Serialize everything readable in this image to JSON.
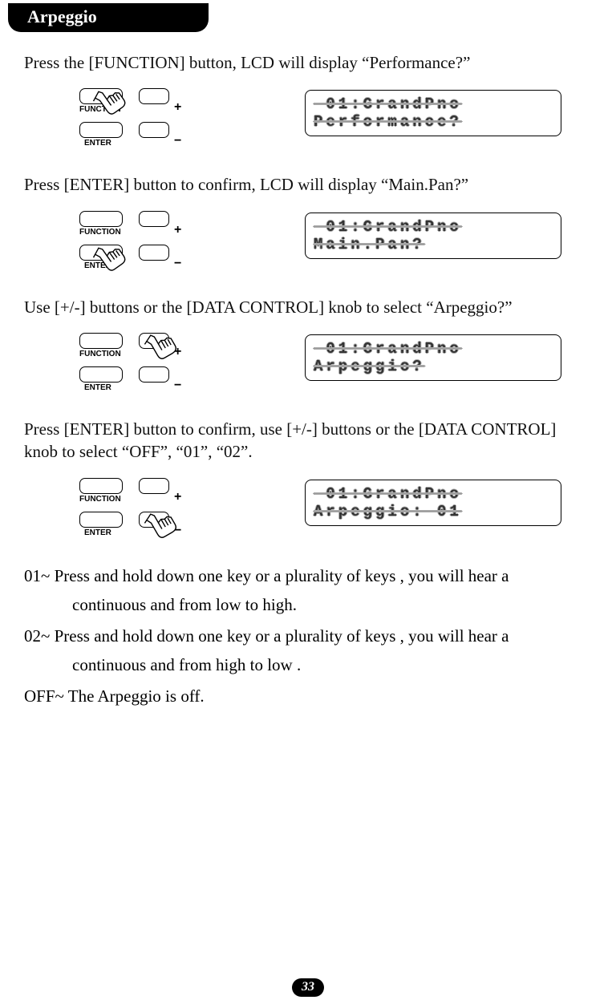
{
  "header": "Arpeggio",
  "steps": [
    {
      "instruction": "Press the [FUNCTION] button, LCD will display “Performance?”",
      "lcd": {
        "line1": " 01:GrandPno",
        "line2": "Performance?"
      }
    },
    {
      "instruction": "Press [ENTER] button to confirm, LCD will display “Main.Pan?”",
      "lcd": {
        "line1": " 01:GrandPno",
        "line2": "Main.Pan?"
      }
    },
    {
      "instruction": "Use [+/-] buttons or the [DATA CONTROL] knob to select “Arpeggio?”",
      "lcd": {
        "line1": " 01:GrandPno",
        "line2": "Arpeggio?"
      }
    },
    {
      "instruction": "Press [ENTER] button to confirm, use [+/-] buttons or the [DATA CONTROL] knob to select “OFF”, “01”, “02”.",
      "lcd": {
        "line1": " 01:GrandPno",
        "line2": "Arpeggio: 01"
      }
    }
  ],
  "panel": {
    "function_label": "FUNCTION",
    "enter_label": "ENTER",
    "plus": "+",
    "minus": "−"
  },
  "descriptions": {
    "d01a": "01~  Press and hold down one key or a plurality of keys , you will hear a",
    "d01b": "continuous and from low to high.",
    "d02a": "02~ Press and hold down one key or a plurality of keys , you will hear a",
    "d02b": "continuous and from high to low .",
    "doff": "OFF~ The Arpeggio is off."
  },
  "page_number": "33"
}
